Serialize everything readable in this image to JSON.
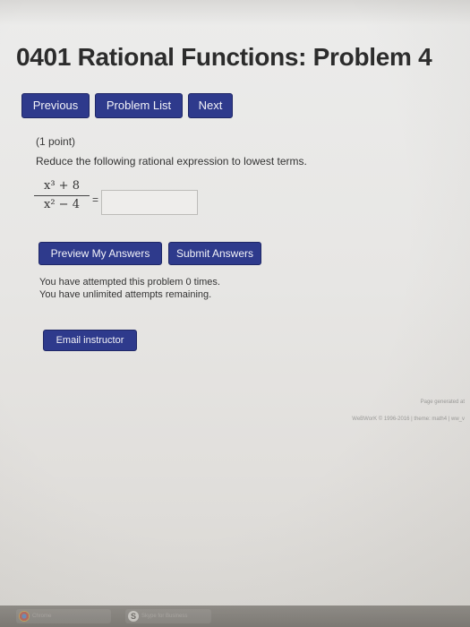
{
  "page": {
    "title": "0401 Rational Functions: Problem 4"
  },
  "nav": {
    "previous_label": "Previous",
    "problem_list_label": "Problem List",
    "next_label": "Next"
  },
  "problem": {
    "points": "(1 point)",
    "instructions": "Reduce the following rational expression to lowest terms.",
    "numerator": "x³ + 8",
    "denominator": "x² − 4",
    "equals": "=",
    "answer_value": ""
  },
  "actions": {
    "preview_label": "Preview My Answers",
    "submit_label": "Submit Answers"
  },
  "attempts": {
    "line1": "You have attempted this problem 0 times.",
    "line2": "You have unlimited attempts remaining."
  },
  "email": {
    "label": "Email instructor"
  },
  "footer": {
    "generated": "Page generated at",
    "copyright": "WeBWorK © 1996-2016 | theme: math4 | ww_v"
  },
  "taskbar": {
    "items": [
      "Chrome",
      "Skype for Business"
    ]
  },
  "colors": {
    "button_bg": "#2e3a8c",
    "page_bg": "#ececeb"
  }
}
